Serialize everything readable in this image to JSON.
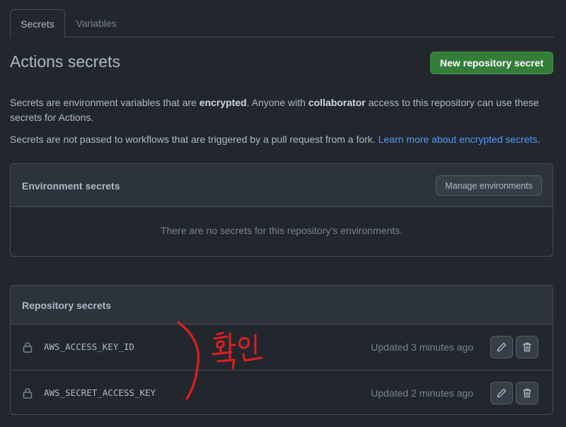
{
  "tabs": [
    {
      "label": "Secrets"
    },
    {
      "label": "Variables"
    }
  ],
  "header": {
    "title": "Actions secrets",
    "new_secret_label": "New repository secret"
  },
  "description": {
    "p1_a": "Secrets are environment variables that are ",
    "p1_b": "encrypted",
    "p1_c": ". Anyone with ",
    "p1_d": "collaborator",
    "p1_e": " access to this repository can use these secrets for Actions.",
    "p2_a": "Secrets are not passed to workflows that are triggered by a pull request from a fork. ",
    "p2_link": "Learn more about encrypted secrets",
    "p2_end": "."
  },
  "environment": {
    "title": "Environment secrets",
    "manage_label": "Manage environments",
    "empty_message": "There are no secrets for this repository’s environments."
  },
  "repository": {
    "title": "Repository secrets",
    "secrets": [
      {
        "name": "AWS_ACCESS_KEY_ID",
        "updated": "Updated 3 minutes ago"
      },
      {
        "name": "AWS_SECRET_ACCESS_KEY",
        "updated": "Updated 2 minutes ago"
      }
    ]
  },
  "annotation": {
    "text": "확인",
    "color": "#e01e1e"
  },
  "colors": {
    "background": "#22272e",
    "primary_button": "#347d39",
    "link": "#539bf5"
  }
}
